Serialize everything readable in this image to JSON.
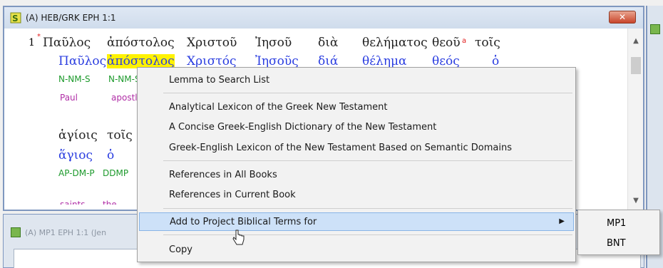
{
  "main_window": {
    "title": "(A) HEB/GRK EPH 1:1",
    "close_label": "✕",
    "verse_number": "1",
    "row1_greek": [
      "Παῦλος",
      "ἀπόστολος",
      "Χριστοῦ",
      "Ἰησοῦ",
      "διὰ",
      "θελήματος",
      "θεοῦ",
      "τοῖς"
    ],
    "row1_lemmas": [
      "Παῦλος",
      "ἀπόστολος",
      "Χριστός",
      "Ἰησοῦς",
      "διά",
      "θέλημα",
      "θεός",
      "ὁ"
    ],
    "row1_parsing": [
      "N-NM-S",
      "N-NM-S"
    ],
    "row1_gloss": [
      "Paul",
      "apostle"
    ],
    "row2_greek": [
      "ἁγίοις",
      "τοῖς"
    ],
    "row2_lemmas": [
      "ἅγιος",
      "ὁ"
    ],
    "row2_parsing": [
      "AP-DM-P",
      "DDMP"
    ],
    "row2_gloss": [
      "saints",
      "the"
    ]
  },
  "bottom_window": {
    "title": "(A) MP1 EPH 1:1 (Jen"
  },
  "context_menu": {
    "items": [
      "Lemma to Search List",
      "Analytical Lexicon of the Greek New Testament",
      "A Concise Greek-English Dictionary of the New Testament",
      "Greek-English Lexicon of the New Testament Based on Semantic Domains",
      "References in All Books",
      "References in Current Book",
      "Add to Project Biblical Terms for",
      "Copy"
    ],
    "submenu_arrow": "▶"
  },
  "submenu": {
    "items": [
      "MP1",
      "BNT"
    ]
  },
  "colors": {
    "lemma": "#2a3de0",
    "parsing": "#1d9a2c",
    "gloss": "#b02ea6",
    "highlight": "#fff200",
    "menu_hover": "#cde1f8"
  }
}
